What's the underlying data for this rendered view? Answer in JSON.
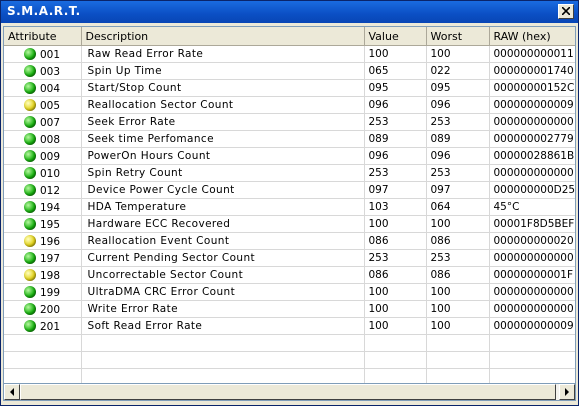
{
  "window": {
    "title": "S.M.A.R.T."
  },
  "columns": [
    "Attribute",
    "Description",
    "Value",
    "Worst",
    "RAW  (hex)"
  ],
  "rows": [
    {
      "status": "green",
      "id": "001",
      "desc": "Raw Read Error Rate",
      "value": "100",
      "worst": "100",
      "raw": "000000000011"
    },
    {
      "status": "green",
      "id": "003",
      "desc": "Spin Up Time",
      "value": "065",
      "worst": "022",
      "raw": "000000001740"
    },
    {
      "status": "green",
      "id": "004",
      "desc": "Start/Stop Count",
      "value": "095",
      "worst": "095",
      "raw": "00000000152C"
    },
    {
      "status": "yellow",
      "id": "005",
      "desc": "Reallocation Sector Count",
      "value": "096",
      "worst": "096",
      "raw": "000000000009"
    },
    {
      "status": "green",
      "id": "007",
      "desc": "Seek Error Rate",
      "value": "253",
      "worst": "253",
      "raw": "000000000000"
    },
    {
      "status": "green",
      "id": "008",
      "desc": "Seek time Perfomance",
      "value": "089",
      "worst": "089",
      "raw": "000000002779"
    },
    {
      "status": "green",
      "id": "009",
      "desc": "PowerOn Hours Count",
      "value": "096",
      "worst": "096",
      "raw": "00000028861B"
    },
    {
      "status": "green",
      "id": "010",
      "desc": "Spin Retry Count",
      "value": "253",
      "worst": "253",
      "raw": "000000000000"
    },
    {
      "status": "green",
      "id": "012",
      "desc": "Device Power Cycle Count",
      "value": "097",
      "worst": "097",
      "raw": "000000000D25"
    },
    {
      "status": "green",
      "id": "194",
      "desc": "HDA Temperature",
      "value": "103",
      "worst": "064",
      "raw": "45°C"
    },
    {
      "status": "green",
      "id": "195",
      "desc": "Hardware ECC Recovered",
      "value": "100",
      "worst": "100",
      "raw": "00001F8D5BEF"
    },
    {
      "status": "yellow",
      "id": "196",
      "desc": "Reallocation Event Count",
      "value": "086",
      "worst": "086",
      "raw": "000000000020"
    },
    {
      "status": "green",
      "id": "197",
      "desc": "Current Pending Sector Count",
      "value": "253",
      "worst": "253",
      "raw": "000000000000"
    },
    {
      "status": "yellow",
      "id": "198",
      "desc": "Uncorrectable Sector Count",
      "value": "086",
      "worst": "086",
      "raw": "00000000001F"
    },
    {
      "status": "green",
      "id": "199",
      "desc": "UltraDMA CRC Error Count",
      "value": "100",
      "worst": "100",
      "raw": "000000000000"
    },
    {
      "status": "green",
      "id": "200",
      "desc": "Write Error Rate",
      "value": "100",
      "worst": "100",
      "raw": "000000000000"
    },
    {
      "status": "green",
      "id": "201",
      "desc": "Soft Read Error Rate",
      "value": "100",
      "worst": "100",
      "raw": "000000000009"
    }
  ],
  "empty_rows": 3,
  "scrollbar": {
    "thumb_fraction": 0.995
  },
  "colors": {
    "title_bar": "#0b4fc4",
    "ok": "#18b20f",
    "warning": "#e2d21a"
  }
}
